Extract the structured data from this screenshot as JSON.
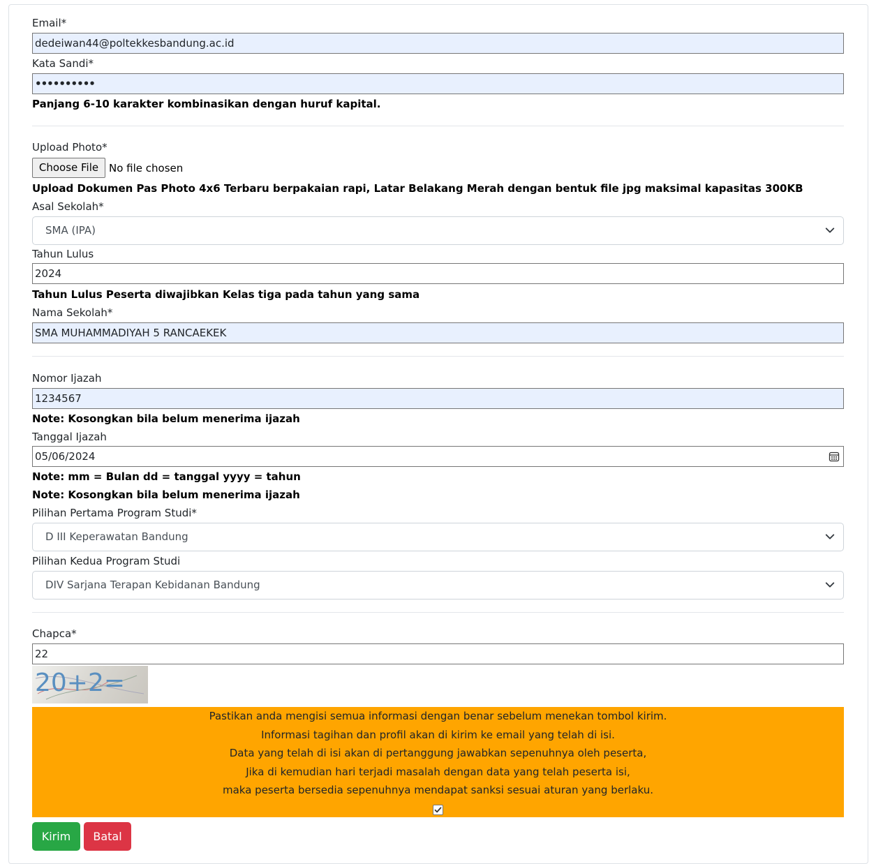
{
  "form": {
    "email": {
      "label": "Email*",
      "value": "dedeiwan44@poltekkesbandung.ac.id"
    },
    "password": {
      "label": "Kata Sandi*",
      "value": "••••••••••",
      "help": "Panjang 6-10 karakter kombinasikan dengan huruf kapital."
    },
    "photo": {
      "label": "Upload Photo*",
      "button_label": "Choose File",
      "status": "No file chosen",
      "help": "Upload Dokumen Pas Photo 4x6 Terbaru berpakaian rapi, Latar Belakang Merah dengan bentuk file jpg maksimal kapasitas 300KB"
    },
    "asal_sekolah": {
      "label": "Asal Sekolah*",
      "selected": "SMA (IPA)"
    },
    "tahun_lulus": {
      "label": "Tahun Lulus",
      "value": "2024",
      "help": "Tahun Lulus Peserta diwajibkan Kelas tiga pada tahun yang sama"
    },
    "nama_sekolah": {
      "label": "Nama Sekolah*",
      "value": "SMA MUHAMMADIYAH 5 RANCAEKEK"
    },
    "nomor_ijazah": {
      "label": "Nomor Ijazah",
      "value": "1234567",
      "note": "Note: Kosongkan bila belum menerima ijazah"
    },
    "tanggal_ijazah": {
      "label": "Tanggal Ijazah",
      "value": "05/06/2024",
      "note_format": "Note: mm = Bulan dd = tanggal yyyy = tahun",
      "note_empty": "Note: Kosongkan bila belum menerima ijazah"
    },
    "prodi_1": {
      "label": "Pilihan Pertama Program Studi*",
      "selected": "D III Keperawatan Bandung"
    },
    "prodi_2": {
      "label": "Pilihan Kedua Program Studi",
      "selected": "DIV Sarjana Terapan Kebidanan Bandung"
    },
    "captcha": {
      "label": "Chapca*",
      "value": "22",
      "image_text": "20+2="
    },
    "notice": {
      "lines": [
        "Pastikan anda mengisi semua informasi dengan benar sebelum menekan tombol kirim.",
        "Informasi tagihan dan profil akan di kirim ke email yang telah di isi.",
        "Data yang telah di isi akan di pertanggung jawabkan sepenuhnya oleh peserta,",
        "Jika di kemudian hari terjadi masalah dengan data yang telah peserta isi,",
        "maka peserta bersedia sepenuhnya mendapat sanksi sesuai aturan yang berlaku."
      ],
      "agree_checked": true,
      "bg_color": "#ffa500"
    },
    "actions": {
      "submit_label": "Kirim",
      "cancel_label": "Batal",
      "submit_color": "#28a745",
      "cancel_color": "#dc3545"
    }
  }
}
